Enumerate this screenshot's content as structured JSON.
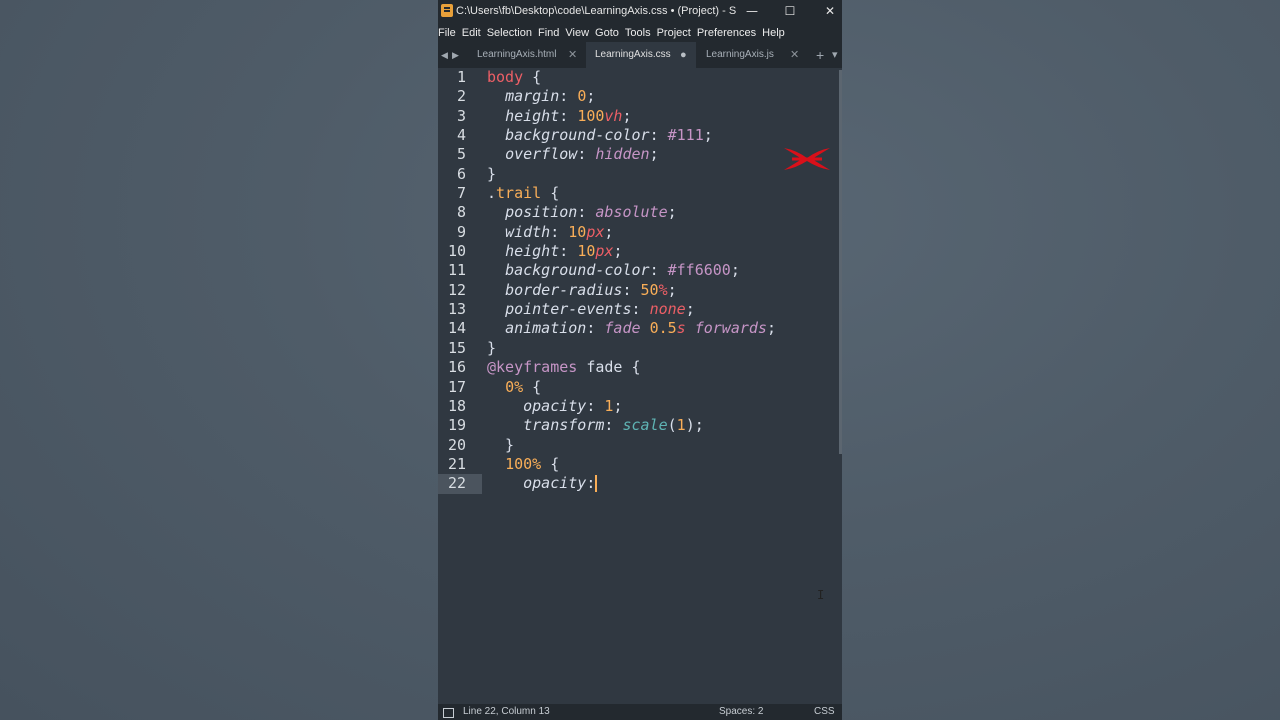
{
  "window": {
    "title": "C:\\Users\\fb\\Desktop\\code\\LearningAxis.css • (Project) - Subl...",
    "minimize": "—",
    "maximize": "☐",
    "close": "✕"
  },
  "menu": [
    "File",
    "Edit",
    "Selection",
    "Find",
    "View",
    "Goto",
    "Tools",
    "Project",
    "Preferences",
    "Help"
  ],
  "tabs": [
    {
      "label": "LearningAxis.html",
      "state": "✕"
    },
    {
      "label": "LearningAxis.css",
      "state": "●"
    },
    {
      "label": "LearningAxis.js",
      "state": "✕"
    }
  ],
  "tabbar": {
    "add": "+",
    "more": "▾",
    "prev": "◀",
    "next": "▶"
  },
  "gutter": [
    "1",
    "2",
    "3",
    "4",
    "5",
    "6",
    "7",
    "8",
    "9",
    "10",
    "11",
    "12",
    "13",
    "14",
    "15",
    "16",
    "17",
    "18",
    "19",
    "20",
    "21",
    "22"
  ],
  "current_line": 22,
  "code": [
    [
      [
        "sel",
        "body"
      ],
      [
        "p",
        " {"
      ]
    ],
    [
      [
        "p",
        "  "
      ],
      [
        "prop",
        "margin"
      ],
      [
        "p",
        ": "
      ],
      [
        "num",
        "0"
      ],
      [
        "p",
        ";"
      ]
    ],
    [
      [
        "p",
        "  "
      ],
      [
        "prop",
        "height"
      ],
      [
        "p",
        ": "
      ],
      [
        "num",
        "100"
      ],
      [
        "unit",
        "vh"
      ],
      [
        "p",
        ";"
      ]
    ],
    [
      [
        "p",
        "  "
      ],
      [
        "prop",
        "background-color"
      ],
      [
        "p",
        ": "
      ],
      [
        "hex",
        "#111"
      ],
      [
        "p",
        ";"
      ]
    ],
    [
      [
        "p",
        "  "
      ],
      [
        "prop",
        "overflow"
      ],
      [
        "p",
        ": "
      ],
      [
        "kw",
        "hidden"
      ],
      [
        "p",
        ";"
      ]
    ],
    [
      [
        "p",
        "}"
      ]
    ],
    [
      [
        "p",
        "."
      ],
      [
        "cls",
        "trail"
      ],
      [
        "p",
        " {"
      ]
    ],
    [
      [
        "p",
        "  "
      ],
      [
        "prop",
        "position"
      ],
      [
        "p",
        ": "
      ],
      [
        "kw",
        "absolute"
      ],
      [
        "p",
        ";"
      ]
    ],
    [
      [
        "p",
        "  "
      ],
      [
        "prop",
        "width"
      ],
      [
        "p",
        ": "
      ],
      [
        "num",
        "10"
      ],
      [
        "unit",
        "px"
      ],
      [
        "p",
        ";"
      ]
    ],
    [
      [
        "p",
        "  "
      ],
      [
        "prop",
        "height"
      ],
      [
        "p",
        ": "
      ],
      [
        "num",
        "10"
      ],
      [
        "unit",
        "px"
      ],
      [
        "p",
        ";"
      ]
    ],
    [
      [
        "p",
        "  "
      ],
      [
        "prop",
        "background-color"
      ],
      [
        "p",
        ": "
      ],
      [
        "hex",
        "#ff6600"
      ],
      [
        "p",
        ";"
      ]
    ],
    [
      [
        "p",
        "  "
      ],
      [
        "prop",
        "border-radius"
      ],
      [
        "p",
        ": "
      ],
      [
        "num",
        "50"
      ],
      [
        "unit",
        "%"
      ],
      [
        "p",
        ";"
      ]
    ],
    [
      [
        "p",
        "  "
      ],
      [
        "prop",
        "pointer-events"
      ],
      [
        "p",
        ": "
      ],
      [
        "unit",
        "none"
      ],
      [
        "p",
        ";"
      ]
    ],
    [
      [
        "p",
        "  "
      ],
      [
        "prop",
        "animation"
      ],
      [
        "p",
        ": "
      ],
      [
        "kw",
        "fade "
      ],
      [
        "num",
        "0.5"
      ],
      [
        "unit",
        "s "
      ],
      [
        "kw",
        "forwards"
      ],
      [
        "p",
        ";"
      ]
    ],
    [
      [
        "p",
        "}"
      ]
    ],
    [
      [
        "at",
        "@keyframes"
      ],
      [
        "p",
        " fade {"
      ]
    ],
    [
      [
        "p",
        "  "
      ],
      [
        "at2",
        "0%"
      ],
      [
        "p",
        " {"
      ]
    ],
    [
      [
        "p",
        "    "
      ],
      [
        "prop",
        "opacity"
      ],
      [
        "p",
        ": "
      ],
      [
        "num",
        "1"
      ],
      [
        "p",
        ";"
      ]
    ],
    [
      [
        "p",
        "    "
      ],
      [
        "prop",
        "transform"
      ],
      [
        "p",
        ": "
      ],
      [
        "fn",
        "scale"
      ],
      [
        "p",
        "("
      ],
      [
        "num",
        "1"
      ],
      [
        "p",
        ");"
      ]
    ],
    [
      [
        "p",
        "  }"
      ]
    ],
    [
      [
        "p",
        "  "
      ],
      [
        "at2",
        "100%"
      ],
      [
        "p",
        " {"
      ]
    ],
    [
      [
        "p",
        "    "
      ],
      [
        "prop",
        "opacity"
      ],
      [
        "p",
        ":"
      ],
      [
        "caret",
        ""
      ]
    ]
  ],
  "status": {
    "position": "Line 22, Column 13",
    "spaces": "Spaces: 2",
    "syntax": "CSS"
  },
  "colors": {
    "editor_bg": "#303841",
    "selector": "#ec5f66",
    "number": "#f9ae58",
    "keyword": "#c695c6",
    "function": "#5fb4b4",
    "logo_red": "#d9101a"
  },
  "icons": {
    "app": "sublime-icon",
    "logo": "red-x-logo",
    "mouse": "ibeam-cursor-icon",
    "status_panel": "panel-toggle-icon"
  }
}
